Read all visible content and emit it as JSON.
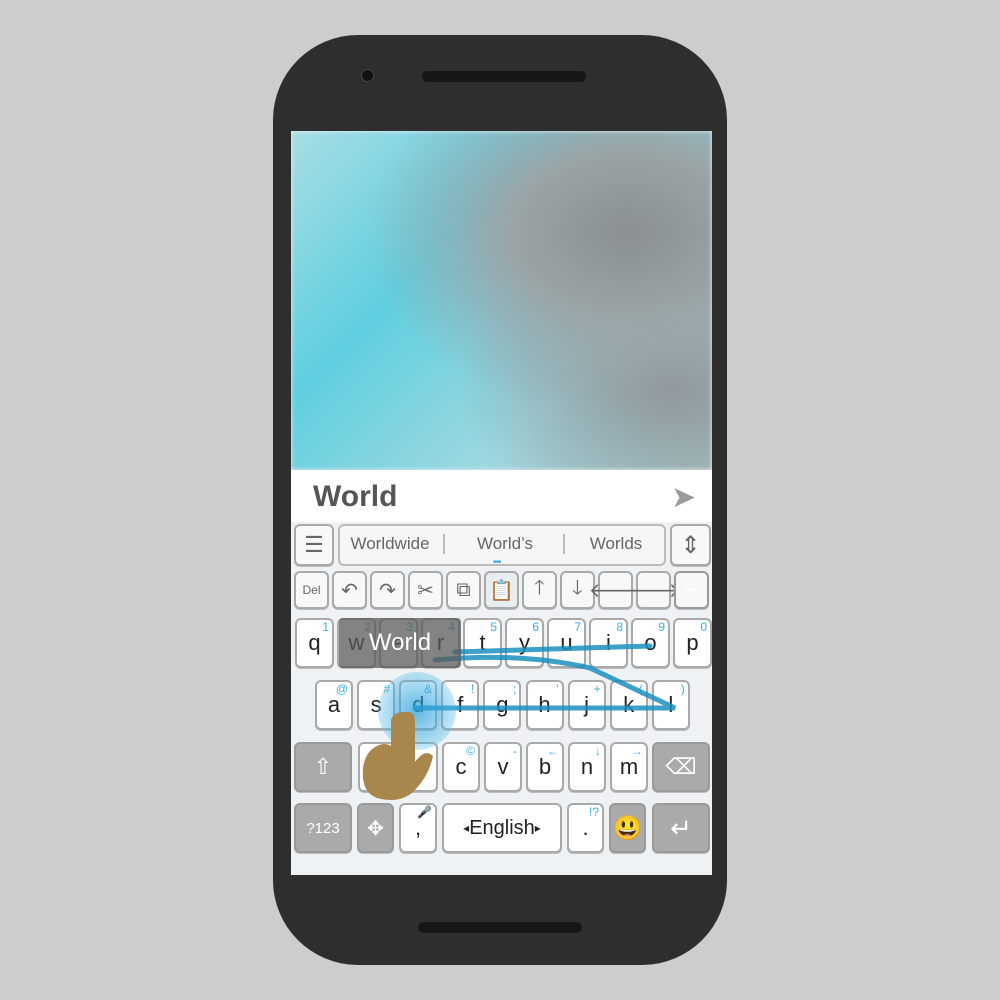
{
  "input": {
    "text": "World",
    "send_icon": "send-icon"
  },
  "suggestions": {
    "menu_icon": "menu-icon",
    "items": [
      "Worldwide",
      "World’s",
      "Worlds"
    ],
    "expand_icon": "vertical-arrows-icon"
  },
  "toolbar": {
    "del_label": "Del",
    "icons": [
      "undo-icon",
      "redo-icon",
      "cut-icon",
      "copy-icon",
      "paste-icon",
      "arrow-up-icon",
      "arrow-down-icon",
      "arrow-left-icon",
      "arrow-right-icon",
      "more-icon"
    ]
  },
  "rows": {
    "row1": [
      {
        "k": "q",
        "h": "1"
      },
      {
        "k": "w",
        "h": "2"
      },
      {
        "k": "e",
        "h": "3"
      },
      {
        "k": "r",
        "h": "4"
      },
      {
        "k": "t",
        "h": "5"
      },
      {
        "k": "y",
        "h": "6"
      },
      {
        "k": "u",
        "h": "7"
      },
      {
        "k": "i",
        "h": "8"
      },
      {
        "k": "o",
        "h": "9"
      },
      {
        "k": "p",
        "h": "0"
      }
    ],
    "row2": [
      {
        "k": "a",
        "h": "@"
      },
      {
        "k": "s",
        "h": "#"
      },
      {
        "k": "d",
        "h": "&"
      },
      {
        "k": "f",
        "h": "!"
      },
      {
        "k": "g",
        "h": ";"
      },
      {
        "k": "h",
        "h": "'"
      },
      {
        "k": "j",
        "h": "+"
      },
      {
        "k": "k",
        "h": "("
      },
      {
        "k": "l",
        "h": ")"
      }
    ],
    "row3": [
      {
        "k": "z",
        "h": ""
      },
      {
        "k": "x",
        "h": ""
      },
      {
        "k": "c",
        "h": "©"
      },
      {
        "k": "v",
        "h": "-"
      },
      {
        "k": "b",
        "h": "←"
      },
      {
        "k": "n",
        "h": "↓"
      },
      {
        "k": "m",
        "h": "→"
      }
    ]
  },
  "bottom": {
    "symbols_label": "?123",
    "comma": ",",
    "comma_hint": "🎤",
    "space_label": "English",
    "period": ".",
    "period_hint": "!?",
    "emoji": "😃"
  },
  "gesture": {
    "popup_word": "World",
    "trail_color": "#1a8fc0"
  }
}
